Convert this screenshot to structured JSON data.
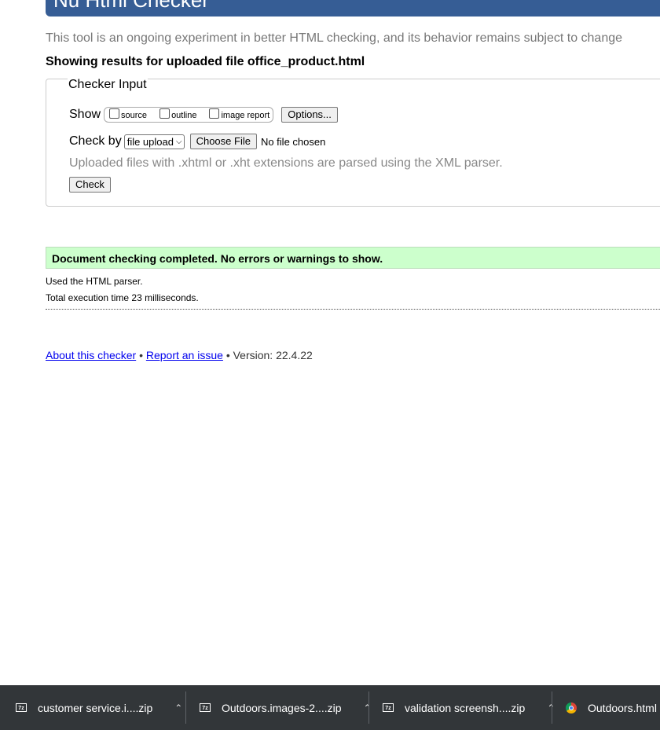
{
  "header": {
    "title": "Nu Html Checker"
  },
  "intro_text": "This tool is an ongoing experiment in better HTML checking, and its behavior remains subject to change",
  "results_heading": "Showing results for uploaded file office_product.html",
  "checker": {
    "legend": "Checker Input",
    "show_label": "Show",
    "show_options": [
      "source",
      "outline",
      "image report"
    ],
    "options_button": "Options...",
    "check_by_label": "Check by",
    "check_by_selected": "file upload",
    "choose_file_button": "Choose File",
    "no_file_text": "No file chosen",
    "note": "Uploaded files with .xhtml or .xht extensions are parsed using the XML parser.",
    "check_button": "Check"
  },
  "result": {
    "success_message": "Document checking completed. No errors or warnings to show.",
    "parser_info": "Used the HTML parser.",
    "execution_time": "Total execution time 23 milliseconds."
  },
  "footer": {
    "about_link": "About this checker",
    "separator": "•",
    "report_link": "Report an issue",
    "version": "Version: 22.4.22"
  },
  "downloads": [
    {
      "name": "customer service.i....zip",
      "icon": "zip-file-icon"
    },
    {
      "name": "Outdoors.images-2....zip",
      "icon": "zip-file-icon"
    },
    {
      "name": "validation screensh....zip",
      "icon": "zip-file-icon"
    },
    {
      "name": "Outdoors.html",
      "icon": "chrome-icon"
    }
  ],
  "zip_icon_text": "7z",
  "colors": {
    "header_bg": "#365d95",
    "success_bg": "#ccffcc",
    "downloads_bar_bg": "#323639",
    "link": "#0000ee"
  }
}
